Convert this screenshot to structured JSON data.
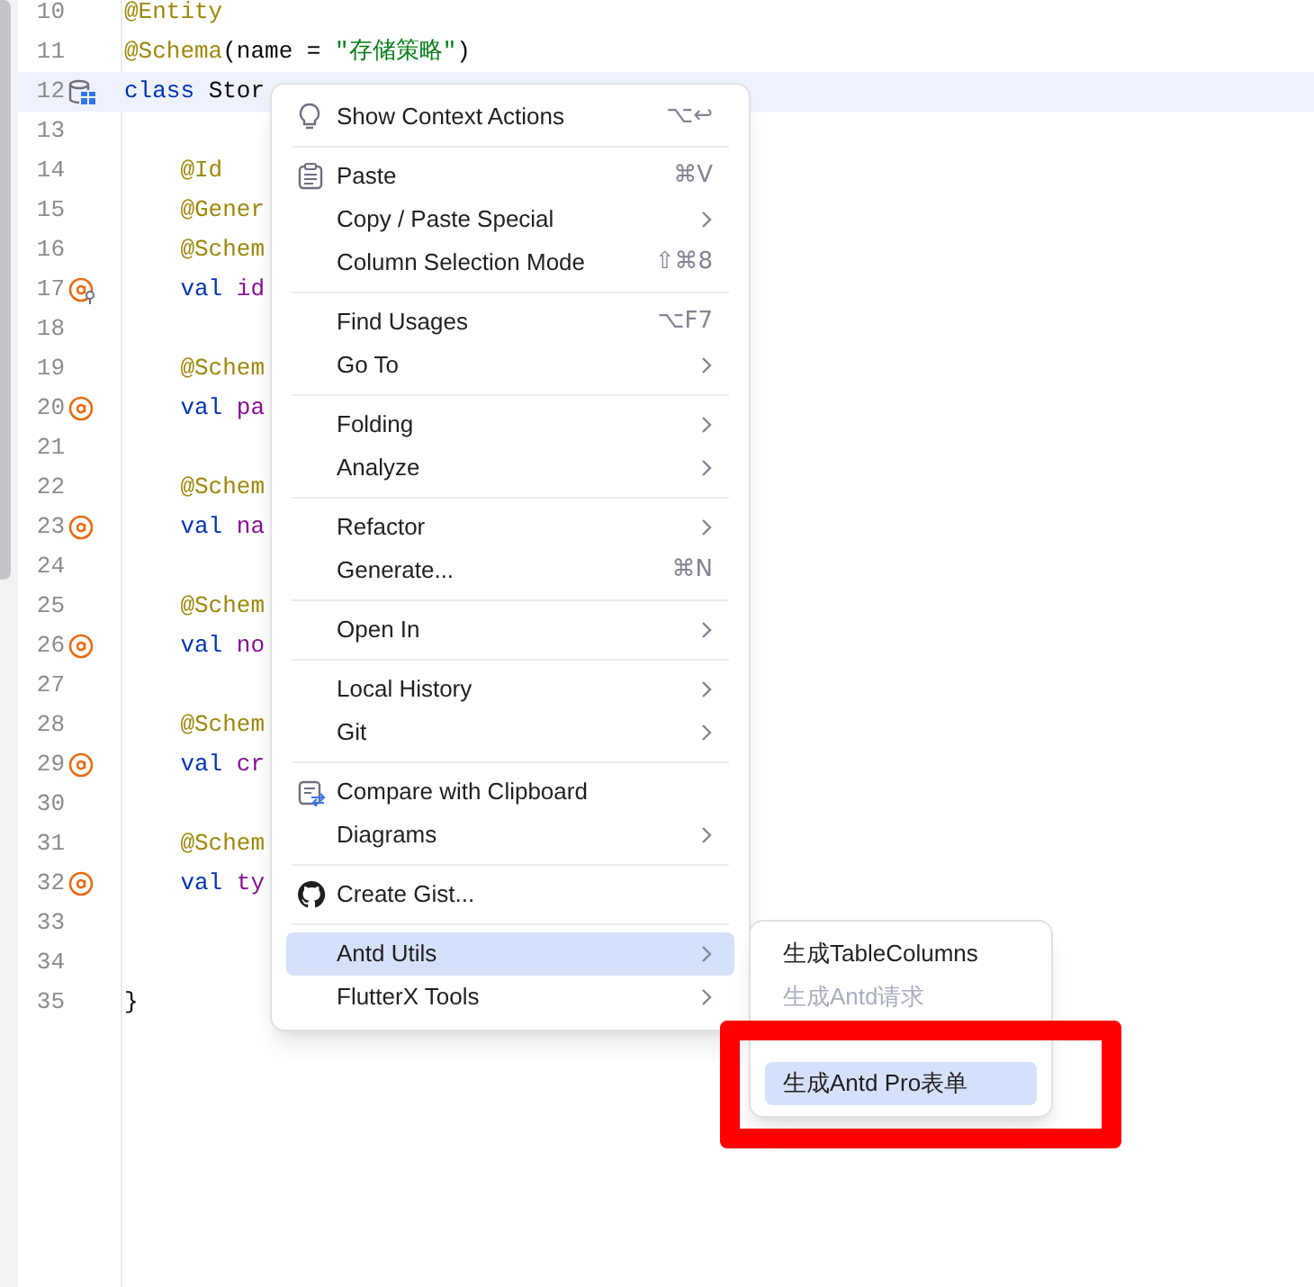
{
  "editor": {
    "lines": [
      {
        "number": "10",
        "kind": "plain",
        "current": false,
        "tokens": [
          {
            "kind": "annotation",
            "text": "@Entity"
          }
        ]
      },
      {
        "number": "11",
        "kind": "plain",
        "current": false,
        "tokens": [
          {
            "kind": "annotation",
            "text": "@Schema"
          },
          {
            "kind": "plain",
            "text": "(name = "
          },
          {
            "kind": "string",
            "text": "\"存储策略\""
          },
          {
            "kind": "plain",
            "text": ")"
          }
        ]
      },
      {
        "number": "12",
        "kind": "entity",
        "current": true,
        "tokens": [
          {
            "kind": "keyword",
            "text": "class"
          },
          {
            "kind": "plain",
            "text": " Stor"
          }
        ]
      },
      {
        "number": "13",
        "kind": "plain",
        "current": false
      },
      {
        "number": "14",
        "kind": "plain",
        "current": false,
        "tokens": [
          {
            "kind": "annotation",
            "text": "    @Id"
          }
        ]
      },
      {
        "number": "15",
        "kind": "plain",
        "current": false,
        "tokens": [
          {
            "kind": "annotation",
            "text": "    @Gener"
          }
        ]
      },
      {
        "number": "16",
        "kind": "plain",
        "current": false,
        "tokens": [
          {
            "kind": "annotation",
            "text": "    @Schem"
          }
        ]
      },
      {
        "number": "17",
        "kind": "id-field",
        "current": false,
        "tokens": [
          {
            "kind": "keyword",
            "text": "    val"
          },
          {
            "kind": "property",
            "text": " id"
          }
        ]
      },
      {
        "number": "18",
        "kind": "plain",
        "current": false
      },
      {
        "number": "19",
        "kind": "plain",
        "current": false,
        "tokens": [
          {
            "kind": "annotation",
            "text": "    @Schem"
          }
        ]
      },
      {
        "number": "20",
        "kind": "field",
        "current": false,
        "tokens": [
          {
            "kind": "keyword",
            "text": "    val"
          },
          {
            "kind": "property",
            "text": " pa"
          }
        ]
      },
      {
        "number": "21",
        "kind": "plain",
        "current": false
      },
      {
        "number": "22",
        "kind": "plain",
        "current": false,
        "tokens": [
          {
            "kind": "annotation",
            "text": "    @Schem"
          }
        ]
      },
      {
        "number": "23",
        "kind": "field",
        "current": false,
        "tokens": [
          {
            "kind": "keyword",
            "text": "    val"
          },
          {
            "kind": "property",
            "text": " na"
          }
        ]
      },
      {
        "number": "24",
        "kind": "plain",
        "current": false
      },
      {
        "number": "25",
        "kind": "plain",
        "current": false,
        "tokens": [
          {
            "kind": "annotation",
            "text": "    @Schem"
          }
        ]
      },
      {
        "number": "26",
        "kind": "field",
        "current": false,
        "tokens": [
          {
            "kind": "keyword",
            "text": "    val"
          },
          {
            "kind": "property",
            "text": " no"
          }
        ]
      },
      {
        "number": "27",
        "kind": "plain",
        "current": false
      },
      {
        "number": "28",
        "kind": "plain",
        "current": false,
        "tokens": [
          {
            "kind": "annotation",
            "text": "    @Schem"
          }
        ]
      },
      {
        "number": "29",
        "kind": "field",
        "current": false,
        "tokens": [
          {
            "kind": "keyword",
            "text": "    val"
          },
          {
            "kind": "property",
            "text": " cr"
          }
        ]
      },
      {
        "number": "30",
        "kind": "plain",
        "current": false
      },
      {
        "number": "31",
        "kind": "plain",
        "current": false,
        "tokens": [
          {
            "kind": "annotation",
            "text": "    @Schem"
          }
        ]
      },
      {
        "number": "32",
        "kind": "field",
        "current": false,
        "tokens": [
          {
            "kind": "keyword",
            "text": "    val"
          },
          {
            "kind": "property",
            "text": " ty"
          }
        ]
      },
      {
        "number": "33",
        "kind": "plain",
        "current": false
      },
      {
        "number": "34",
        "kind": "plain",
        "current": false
      },
      {
        "number": "35",
        "kind": "plain",
        "current": false,
        "tokens": [
          {
            "kind": "plain",
            "text": "}"
          }
        ]
      }
    ]
  },
  "context_menu": {
    "items": [
      {
        "kind": "item",
        "label": "Show Context Actions",
        "shortcut": "⌥↩",
        "selected": false
      },
      {
        "kind": "separator"
      },
      {
        "kind": "item",
        "label": "Paste",
        "shortcut": "⌘V",
        "selected": false
      },
      {
        "kind": "submenu",
        "label": "Copy / Paste Special",
        "selected": false
      },
      {
        "kind": "item",
        "label": "Column Selection Mode",
        "shortcut": "⇧⌘8",
        "selected": false
      },
      {
        "kind": "separator"
      },
      {
        "kind": "item",
        "label": "Find Usages",
        "shortcut": "⌥F7",
        "selected": false
      },
      {
        "kind": "submenu",
        "label": "Go To",
        "selected": false
      },
      {
        "kind": "separator"
      },
      {
        "kind": "submenu",
        "label": "Folding",
        "selected": false
      },
      {
        "kind": "submenu",
        "label": "Analyze",
        "selected": false
      },
      {
        "kind": "separator"
      },
      {
        "kind": "submenu",
        "label": "Refactor",
        "selected": false
      },
      {
        "kind": "item",
        "label": "Generate...",
        "shortcut": "⌘N",
        "selected": false
      },
      {
        "kind": "separator"
      },
      {
        "kind": "submenu",
        "label": "Open In",
        "selected": false
      },
      {
        "kind": "separator"
      },
      {
        "kind": "submenu",
        "label": "Local History",
        "selected": false
      },
      {
        "kind": "submenu",
        "label": "Git",
        "selected": false
      },
      {
        "kind": "separator"
      },
      {
        "kind": "item",
        "label": "Compare with Clipboard",
        "selected": false
      },
      {
        "kind": "submenu",
        "label": "Diagrams",
        "selected": false
      },
      {
        "kind": "separator"
      },
      {
        "kind": "item",
        "label": "Create Gist...",
        "selected": false
      },
      {
        "kind": "separator"
      },
      {
        "kind": "submenu",
        "label": "Antd Utils",
        "selected": true
      },
      {
        "kind": "submenu",
        "label": "FlutterX Tools",
        "selected": false
      }
    ]
  },
  "submenu": {
    "items": [
      {
        "label": "生成TableColumns",
        "disabled": false,
        "selected": false
      },
      {
        "label": "生成Antd请求",
        "disabled": true,
        "selected": false
      },
      {
        "label": "生成Antd Pro表单",
        "disabled": false,
        "selected": true
      }
    ]
  }
}
